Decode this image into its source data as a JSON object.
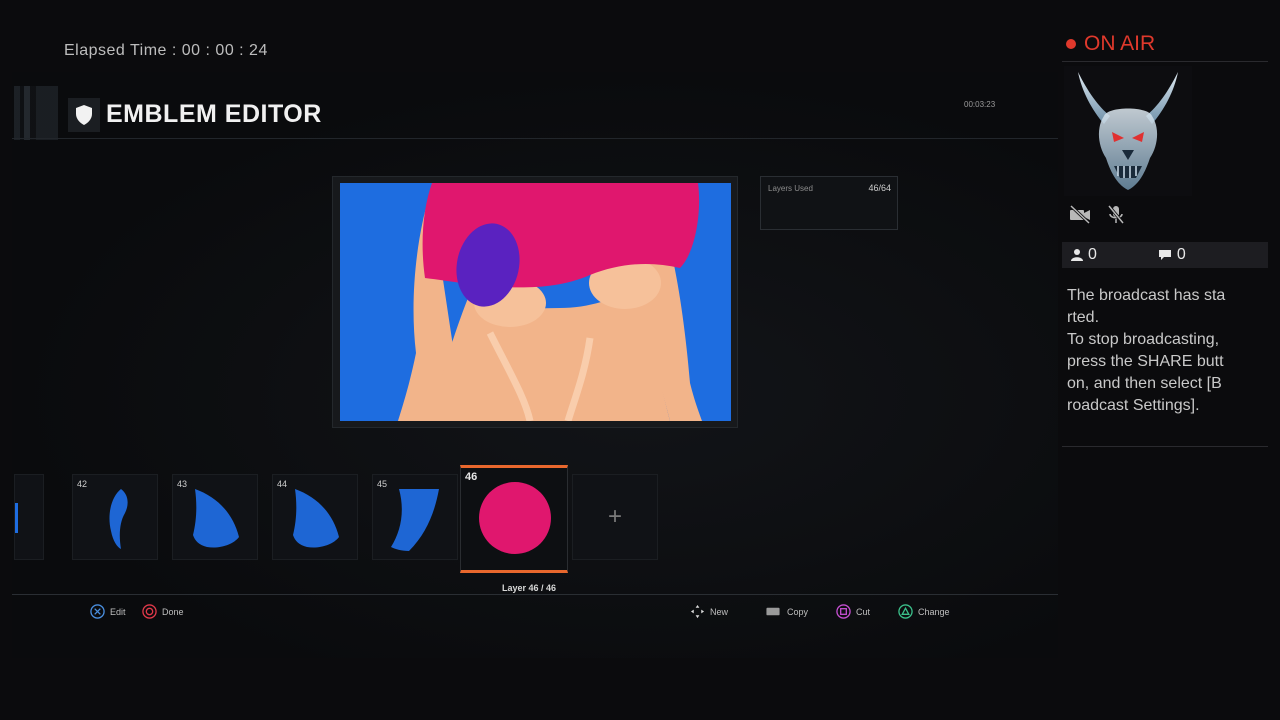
{
  "stream": {
    "elapsed_label": "Elapsed Time",
    "elapsed_value": "00 : 00 : 24",
    "on_air": "ON AIR",
    "viewers": "0",
    "comments": "0",
    "message": "The broadcast has started.\nTo stop broadcasting, press the SHARE button, and then select [Broadcast Settings]."
  },
  "editor": {
    "title": "EMBLEM EDITOR",
    "corner_id": "00:03:23",
    "layers_used_label": "Layers Used",
    "layers_used_value": "46/64",
    "layer_caption": "Layer 46 / 46",
    "add_symbol": "+"
  },
  "layers": [
    {
      "num": "42",
      "shape": "sliver"
    },
    {
      "num": "43",
      "shape": "wedge"
    },
    {
      "num": "44",
      "shape": "wedge"
    },
    {
      "num": "45",
      "shape": "sleeve"
    },
    {
      "num": "46",
      "shape": "circle",
      "selected": true
    }
  ],
  "hints_left": [
    {
      "button": "cross",
      "label": "Edit",
      "color": "#4a8fe0"
    },
    {
      "button": "circle",
      "label": "Done",
      "color": "#e0394a"
    }
  ],
  "hints_right": [
    {
      "button": "dpad",
      "label": "New",
      "color": "#dddddd"
    },
    {
      "button": "touchpad",
      "label": "Copy",
      "color": "#9a9a9a"
    },
    {
      "button": "square",
      "label": "Cut",
      "color": "#c44fd0"
    },
    {
      "button": "triangle",
      "label": "Change",
      "color": "#3bbf8a"
    }
  ],
  "colors": {
    "canvas_bg": "#1e6de0",
    "shirt": "#e0176e",
    "patch": "#5a22c0",
    "skin": "#f2b48a",
    "selected_border": "#e8672d",
    "on_air": "#e0392c",
    "layer_shape": "#1e66d4"
  }
}
